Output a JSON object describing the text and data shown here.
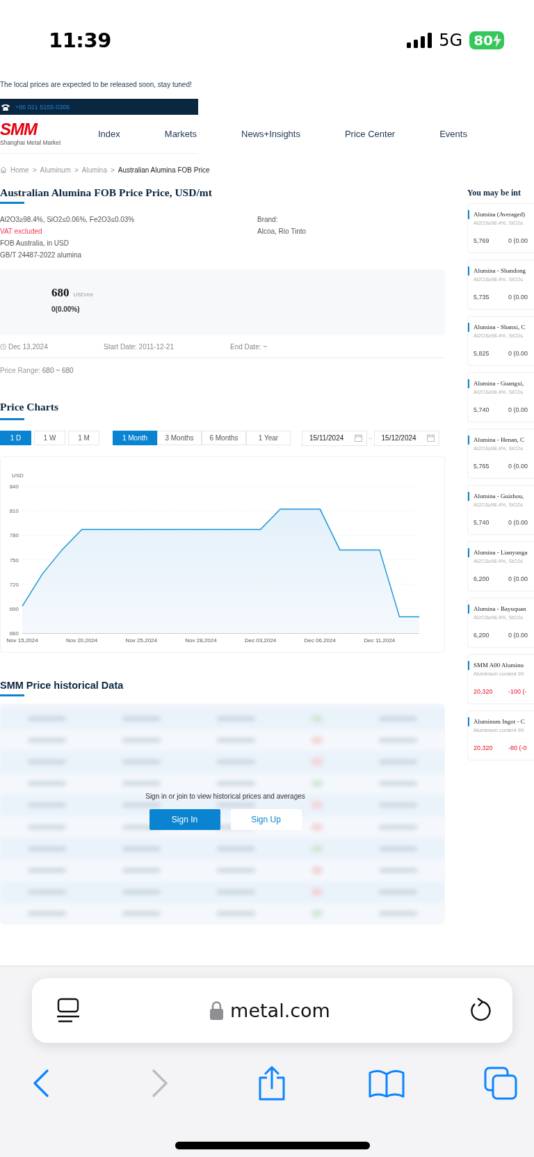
{
  "status_bar": {
    "time": "11:39",
    "network": "5G",
    "battery": "80"
  },
  "notice": "The local prices are expected to be released soon, stay tuned!",
  "contact": {
    "phone": "+86 021 5155-0306"
  },
  "logo": {
    "mark": "SMM",
    "name": "Shanghai Metal Market"
  },
  "nav": [
    {
      "label": "Index"
    },
    {
      "label": "Markets"
    },
    {
      "label": "News+Insights"
    },
    {
      "label": "Price Center"
    },
    {
      "label": "Events"
    }
  ],
  "breadcrumb": [
    {
      "label": "Home",
      "current": false
    },
    {
      "separator": ">",
      "label": "Aluminum",
      "current": false
    },
    {
      "separator": ">",
      "label": "Alumina",
      "current": false
    },
    {
      "separator": ">",
      "label": "Australian Alumina FOB Price",
      "current": true
    }
  ],
  "product": {
    "title": "Australian Alumina FOB Price Price, USD/mt",
    "specs": [
      {
        "text": "Al2O3≥98.4%, SiO2≤0.06%, Fe2O3≤0.03%",
        "kind": "plain"
      },
      {
        "text": "VAT excluded",
        "kind": "alert"
      },
      {
        "text": "FOB Australia, in USD",
        "kind": "plain"
      },
      {
        "text": "GB/T 24487-2022 alumina",
        "kind": "plain"
      }
    ],
    "brand_label": "Brand:",
    "brand": "Alcoa, Rio Tinto"
  },
  "quote": {
    "price": "680",
    "unit": "USD/mt",
    "change": "0(0.00%)",
    "date": "Dec 13,2024",
    "start_date": "Start Date: 2011-12-21",
    "end_date": "End Date: ~",
    "price_range_label": "Price Range:",
    "price_range": "680 ~ 680"
  },
  "price_charts": {
    "title": "Price Charts",
    "intervals": [
      {
        "label": "1 D",
        "selected": true
      },
      {
        "label": "1 W",
        "selected": false
      },
      {
        "label": "1 M",
        "selected": false
      }
    ],
    "periods": [
      {
        "label": "1 Month",
        "selected": true
      },
      {
        "label": "3 Months",
        "selected": false
      },
      {
        "label": "6 Months",
        "selected": false
      },
      {
        "label": "1 Year",
        "selected": false
      }
    ],
    "date_from": "15/11/2024",
    "date_separator": "–",
    "date_to": "15/12/2024",
    "chart_data": {
      "type": "area",
      "ylabel": "USD",
      "grid": true,
      "categories": [
        "Nov 15,2024",
        null,
        null,
        "Nov 20,2024",
        null,
        null,
        "Nov 25,2024",
        null,
        null,
        "Nov 28,2024",
        null,
        null,
        "Dec 03,2024",
        null,
        null,
        "Dec 06,2024",
        null,
        null,
        "Dec 11,2024",
        null,
        null
      ],
      "series": [
        {
          "color": "#1a96d4",
          "values": [
            693,
            732,
            762,
            787,
            787,
            787,
            787,
            787,
            787,
            787,
            787,
            787,
            787,
            812,
            812,
            812,
            762,
            762,
            762,
            680,
            680
          ]
        }
      ],
      "ylim": [
        660,
        840
      ],
      "yticks": [
        660,
        690,
        720,
        750,
        780,
        810,
        840
      ]
    }
  },
  "historical": {
    "title": "SMM Price historical Data",
    "prompt": "Sign in or join to view historical prices and averages",
    "buttons": [
      {
        "label": "Sign In",
        "kind": "primary"
      },
      {
        "label": "Sign Up",
        "kind": "secondary"
      }
    ]
  },
  "sidebar": {
    "title": "You may be int",
    "cards": [
      {
        "title": "Alumina (Averaged)",
        "spec": "Al2O3≥98.4%, SiO2≤",
        "price": "5,769",
        "change": "0 (0.00",
        "kind": "flat"
      },
      {
        "title": "Alumina - Shandong",
        "spec": "Al2O3≥98.4%, SiO2≤",
        "price": "5,735",
        "change": "0 (0.00",
        "kind": "flat"
      },
      {
        "title": "Alumina - Shanxi, C",
        "spec": "Al2O3≥98.4%, SiO2≤",
        "price": "5,825",
        "change": "0 (0.00",
        "kind": "flat"
      },
      {
        "title": "Alumina - Guangxi,",
        "spec": "Al2O3≥98.4%, SiO2≤",
        "price": "5,740",
        "change": "0 (0.00",
        "kind": "flat"
      },
      {
        "title": "Alumina - Henan, C",
        "spec": "Al2O3≥98.4%, SiO2≤",
        "price": "5,765",
        "change": "0 (0.00",
        "kind": "flat"
      },
      {
        "title": "Alumina - Guizhou,",
        "spec": "Al2O3≥98.4%, SiO2≤",
        "price": "5,740",
        "change": "0 (0.00",
        "kind": "flat"
      },
      {
        "title": "Alumina - Lianyunga",
        "spec": "Al2O3≥98.4%, SiO2≤",
        "price": "6,200",
        "change": "0 (0.00",
        "kind": "flat"
      },
      {
        "title": "Alumina - Bayuquan",
        "spec": "Al2O3≥98.4%,  SiO2≤",
        "price": "6,200",
        "change": "0 (0.00",
        "kind": "flat"
      },
      {
        "title": "SMM A00 Aluminu",
        "spec": "Aluminium content 99",
        "price": "20,320",
        "change": "-100 (-",
        "kind": "down"
      },
      {
        "title": "Aluminum Ingot - C",
        "spec": "Aluminium content 99",
        "price": "20,320",
        "change": "-80 (-0",
        "kind": "down"
      }
    ]
  },
  "browser": {
    "url": "metal.com"
  }
}
